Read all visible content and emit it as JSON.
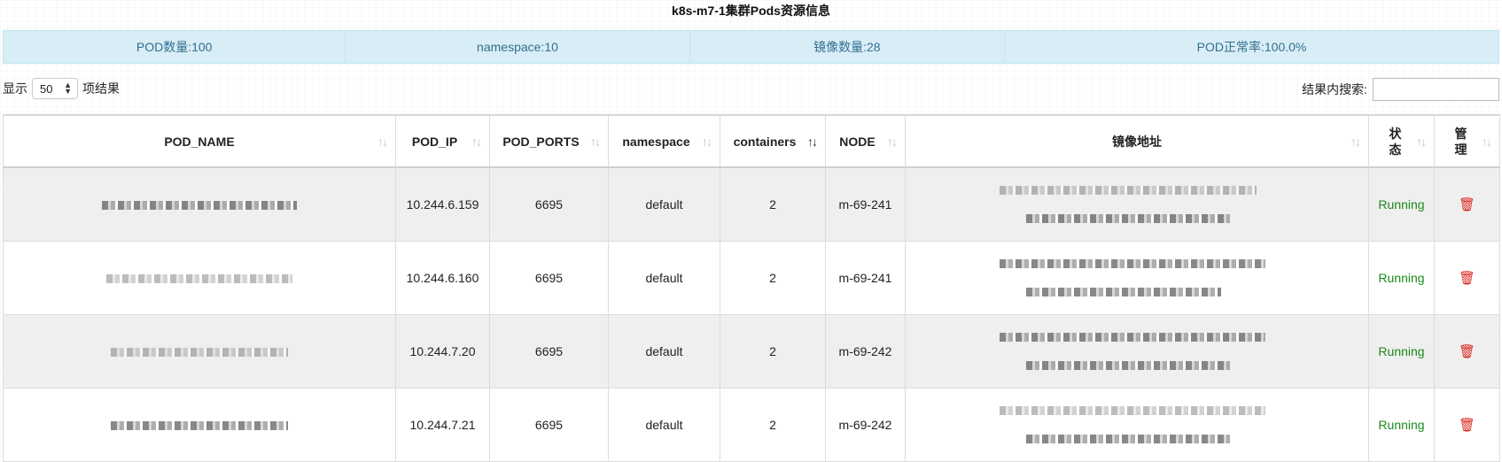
{
  "title": "k8s-m7-1集群Pods资源信息",
  "stats": [
    {
      "label": "POD数量:100"
    },
    {
      "label": "namespace:10"
    },
    {
      "label": "镜像数量:28"
    },
    {
      "label": "POD正常率:100.0%"
    }
  ],
  "length": {
    "prefix": "显示",
    "value": "50",
    "suffix": "项结果"
  },
  "search": {
    "label": "结果内搜索:",
    "value": ""
  },
  "columns": [
    {
      "label": "POD_NAME"
    },
    {
      "label": "POD_IP"
    },
    {
      "label": "POD_PORTS"
    },
    {
      "label": "namespace"
    },
    {
      "label": "containers"
    },
    {
      "label": "NODE"
    },
    {
      "label": "镜像地址"
    },
    {
      "label": "状态"
    },
    {
      "label": "管理"
    }
  ],
  "rows": [
    {
      "ip": "10.244.6.159",
      "ports": "6695",
      "namespace": "default",
      "containers": "2",
      "node": "m-69-241",
      "status": "Running"
    },
    {
      "ip": "10.244.6.160",
      "ports": "6695",
      "namespace": "default",
      "containers": "2",
      "node": "m-69-241",
      "status": "Running"
    },
    {
      "ip": "10.244.7.20",
      "ports": "6695",
      "namespace": "default",
      "containers": "2",
      "node": "m-69-242",
      "status": "Running"
    },
    {
      "ip": "10.244.7.21",
      "ports": "6695",
      "namespace": "default",
      "containers": "2",
      "node": "m-69-242",
      "status": "Running"
    }
  ],
  "icons": {
    "sort": "sort-icon",
    "delete": "trash-icon"
  },
  "colors": {
    "stats_bg": "#d9edf7",
    "stats_text": "#31708f",
    "running": "#1a8a1a",
    "delete": "#d9241c"
  }
}
